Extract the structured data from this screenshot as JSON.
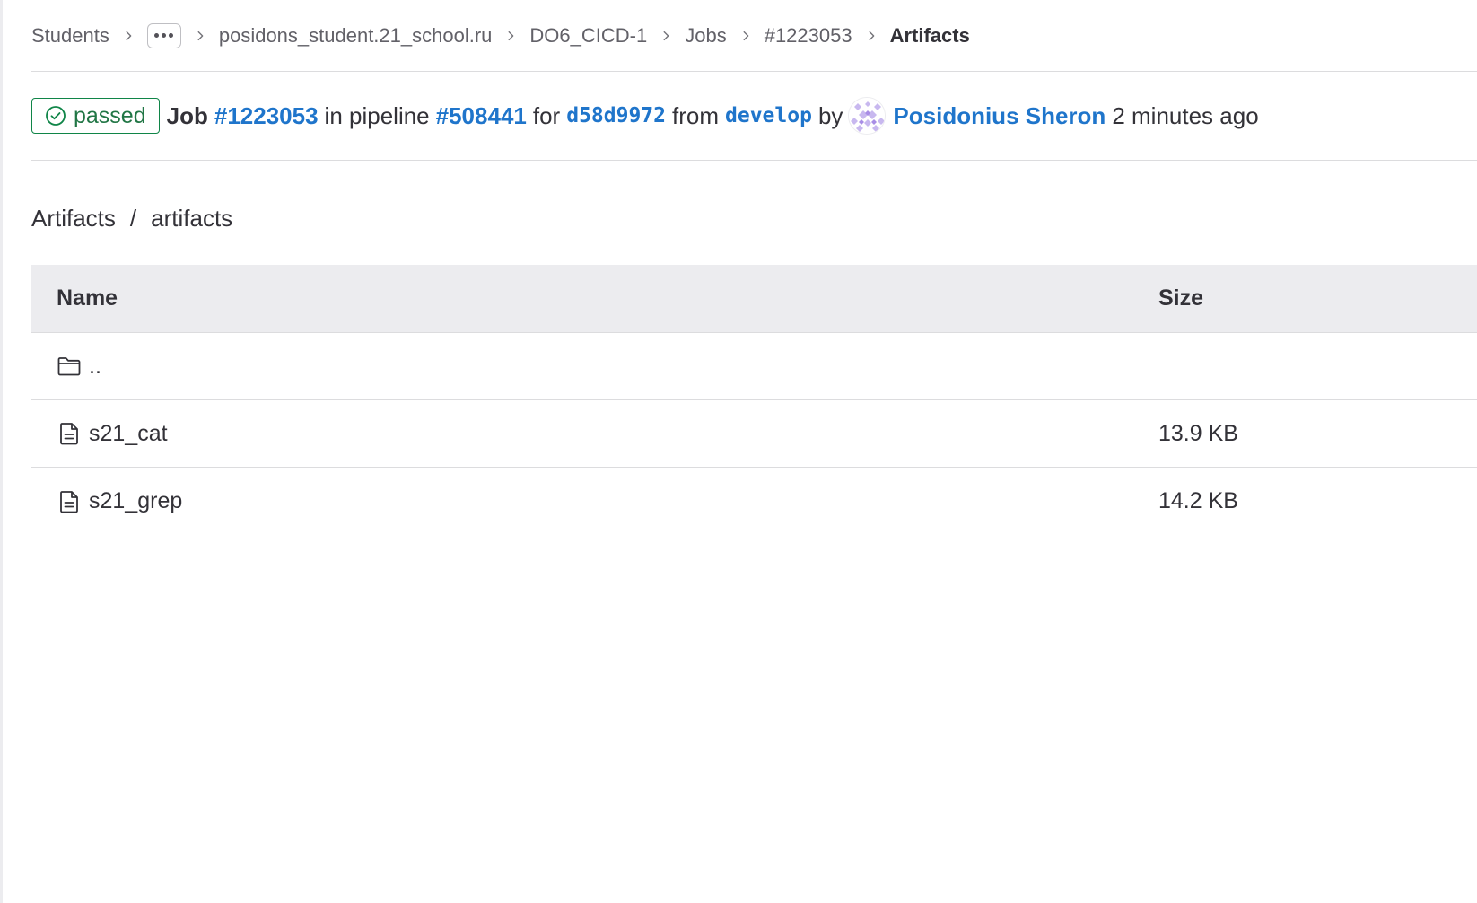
{
  "breadcrumb": {
    "items": [
      {
        "label": "Students"
      },
      {
        "label": "posidons_student.21_school.ru"
      },
      {
        "label": "DO6_CICD-1"
      },
      {
        "label": "Jobs"
      },
      {
        "label": "#1223053"
      },
      {
        "label": "Artifacts"
      }
    ],
    "ellipsis_icon": "ellipsis-icon",
    "separator_icon": "chevron-right-icon"
  },
  "job": {
    "status": "passed",
    "status_icon": "check-circle-icon",
    "status_color": "#108548",
    "job_label": "Job",
    "job_id": "#1223053",
    "in_pipeline": "in pipeline",
    "pipeline_id": "#508441",
    "for_label": "for",
    "commit": "d58d9972",
    "from_label": "from",
    "branch": "develop",
    "by_label": "by",
    "author": "Posidonius Sheron",
    "time": "2 minutes ago",
    "link_color": "#1f75cb"
  },
  "path": {
    "root": "Artifacts",
    "separator": "/",
    "folder": "artifacts"
  },
  "table": {
    "headers": {
      "name": "Name",
      "size": "Size"
    },
    "rows": [
      {
        "icon": "folder-icon",
        "name": "..",
        "size": ""
      },
      {
        "icon": "file-icon",
        "name": "s21_cat",
        "size": "13.9 KB"
      },
      {
        "icon": "file-icon",
        "name": "s21_grep",
        "size": "14.2 KB"
      }
    ]
  }
}
